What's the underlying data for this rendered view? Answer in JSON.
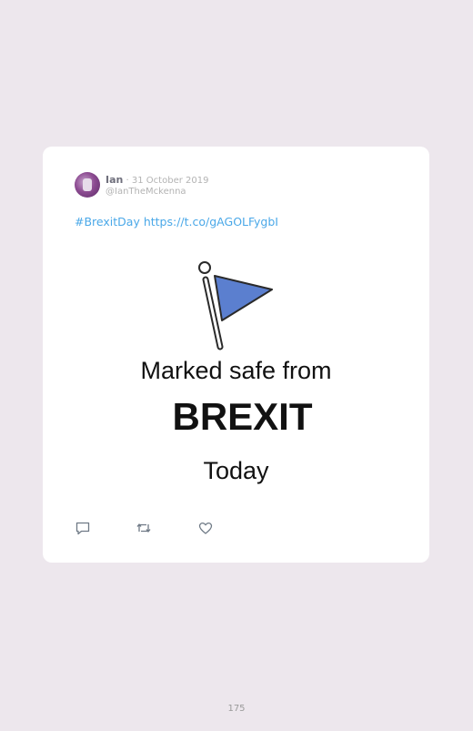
{
  "tweet": {
    "author_name": "Ian",
    "separator": " · ",
    "date": "31 October 2019",
    "handle": "@IanTheMckenna",
    "hashtag": "#BrexitDay",
    "link": "https://t.co/gAGOLFygbI",
    "media": {
      "line1": "Marked safe from",
      "line2": "BREXIT",
      "line3": "Today",
      "flag_color": "#5b7fcf",
      "icon": "flag-icon"
    },
    "actions": {
      "reply_icon": "reply-icon",
      "retweet_icon": "retweet-icon",
      "like_icon": "heart-icon"
    }
  },
  "page": {
    "number": "175"
  },
  "colors": {
    "background": "#ede7ed",
    "card": "#ffffff",
    "link": "#4aa8e8"
  }
}
